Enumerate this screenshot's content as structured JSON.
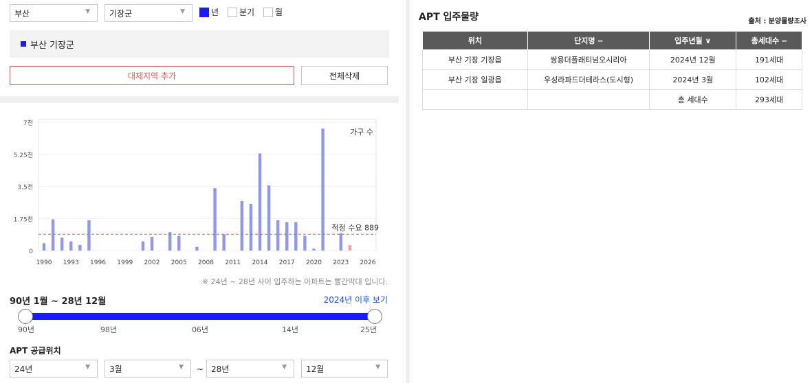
{
  "filters": {
    "province": "부산",
    "district": "기장군",
    "period_options": [
      {
        "label": "년",
        "checked": true
      },
      {
        "label": "분기",
        "checked": false
      },
      {
        "label": "월",
        "checked": false
      }
    ]
  },
  "region_list": {
    "item": "부산 기장군"
  },
  "buttons": {
    "add_region": "대체지역 추가",
    "delete_all": "전체삭제"
  },
  "chart_data": {
    "type": "bar",
    "series_label": "가구 수",
    "x": [
      1990,
      1991,
      1992,
      1993,
      1994,
      1995,
      1996,
      1997,
      1998,
      1999,
      2000,
      2001,
      2002,
      2003,
      2004,
      2005,
      2006,
      2007,
      2008,
      2009,
      2010,
      2011,
      2012,
      2013,
      2014,
      2015,
      2016,
      2017,
      2018,
      2019,
      2020,
      2021,
      2022,
      2023,
      2024
    ],
    "values": [
      400,
      1700,
      700,
      500,
      300,
      1650,
      0,
      0,
      0,
      0,
      0,
      500,
      750,
      0,
      1000,
      800,
      0,
      200,
      0,
      3400,
      900,
      0,
      2700,
      2550,
      5300,
      3550,
      1650,
      1550,
      1550,
      800,
      100,
      6650,
      0,
      950,
      293
    ],
    "highlight_from": 2024,
    "bar_color": "#8f97f3",
    "highlight_color": "#f4a29b",
    "ylim": [
      0,
      7000
    ],
    "y_ticks": [
      "0",
      "1.75천",
      "3.5천",
      "5.25천",
      "7천"
    ],
    "y_tick_values": [
      0,
      1750,
      3500,
      5250,
      7000
    ],
    "x_ticks": [
      "1990",
      "1993",
      "1996",
      "1999",
      "2002",
      "2005",
      "2008",
      "2011",
      "2014",
      "2017",
      "2020",
      "2023",
      "2026"
    ],
    "xlim": [
      1990,
      2026
    ],
    "reference_line": {
      "value": 889,
      "label": "적정 수요 889",
      "color": "#e25555"
    }
  },
  "note": "※ 24년 ~ 28년 사이 입주하는 아파트는 빨간막대 입니다.",
  "period_label": "90년 1월 ~ 28년 12월",
  "after_link": "2024년 이후 보기",
  "slider_ticks": [
    "90년",
    "98년",
    "06년",
    "14년",
    "25년"
  ],
  "supply": {
    "label": "APT 공급위치",
    "from_year": "24년",
    "from_month": "3월",
    "tilde": "~",
    "to_year": "28년",
    "to_month": "12월"
  },
  "right": {
    "title": "APT 입주물량",
    "source": "출처 : 분양물량조사",
    "headers": [
      "위치",
      "단지명 ‒",
      "입주년월 ∨",
      "총세대수 ‒"
    ],
    "rows": [
      [
        "부산 기장 기장읍",
        "쌍용더플래티넘오시리아",
        "2024년 12월",
        "191세대"
      ],
      [
        "부산 기장 일광읍",
        "우성라파드더테라스(도시형)",
        "2024년 3월",
        "102세대"
      ],
      [
        "",
        "",
        "총 세대수",
        "293세대"
      ]
    ]
  },
  "colors": {
    "accent": "#1a1aff",
    "red": "#e25555",
    "header_bg": "#5a5a5a"
  }
}
